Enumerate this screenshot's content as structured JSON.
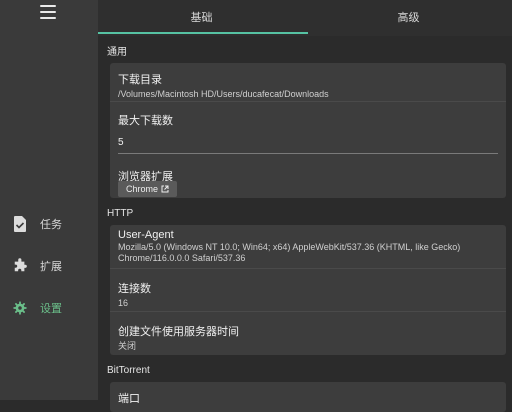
{
  "sidebar": {
    "items": [
      {
        "label": "任务",
        "icon": "file-check-icon"
      },
      {
        "label": "扩展",
        "icon": "puzzle-icon"
      },
      {
        "label": "设置",
        "icon": "gear-icon"
      }
    ],
    "active_color": "#6bbf8a"
  },
  "tabs": [
    {
      "label": "基础",
      "active": true
    },
    {
      "label": "高级",
      "active": false
    }
  ],
  "accent_color": "#56c2a3",
  "sections": {
    "general": {
      "title": "通用",
      "download_dir_label": "下载目录",
      "download_dir_value": "/Volumes/Macintosh HD/Users/ducafecat/Downloads",
      "max_downloads_label": "最大下载数",
      "max_downloads_value": "5",
      "browser_ext_label": "浏览器扩展",
      "browser_ext_button": "Chrome"
    },
    "http": {
      "title": "HTTP",
      "ua_label": "User-Agent",
      "ua_value_line1": "Mozilla/5.0 (Windows NT 10.0; Win64; x64) AppleWebKit/537.36 (KHTML, like Gecko)",
      "ua_value_line2": "Chrome/116.0.0.0 Safari/537.36",
      "connections_label": "连接数",
      "connections_value": "16",
      "server_time_label": "创建文件使用服务器时间",
      "server_time_value": "关闭"
    },
    "bittorrent": {
      "title": "BitTorrent",
      "port_label": "端口"
    }
  }
}
